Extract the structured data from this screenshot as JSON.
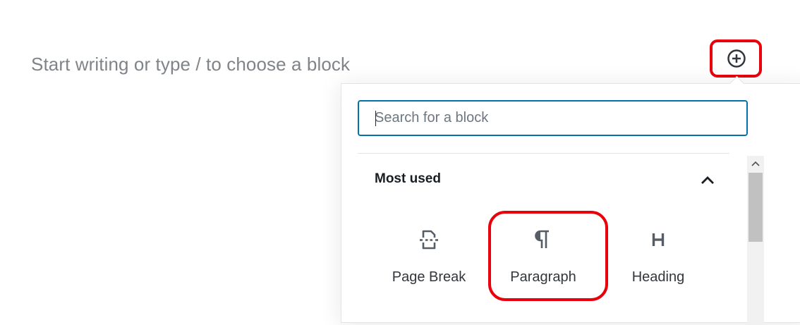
{
  "editor": {
    "placeholder": "Start writing or type / to choose a block"
  },
  "toolbar": {
    "inserter_icon": "plus-circle-icon"
  },
  "inserter": {
    "search": {
      "placeholder": "Search for a block",
      "value": ""
    },
    "panel": {
      "title": "Most used",
      "expanded": true,
      "toggle_icon": "chevron-up-icon"
    },
    "blocks": [
      {
        "label": "Page Break",
        "icon": "page-break-icon"
      },
      {
        "label": "Paragraph",
        "icon": "paragraph-icon"
      },
      {
        "label": "Heading",
        "icon": "heading-icon"
      }
    ]
  },
  "colors": {
    "focus_blue": "#0073aa",
    "highlight_red": "#e8000b",
    "placeholder_gray": "#808488",
    "icon_dark": "#555d66"
  }
}
